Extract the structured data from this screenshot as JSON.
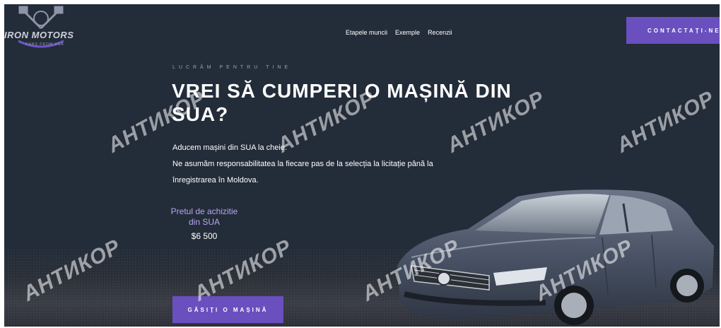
{
  "header": {
    "logo_text": "IRON MOTORS",
    "logo_sub": "CARS FROM USA",
    "nav": [
      "Etapele muncii",
      "Exemple",
      "Recenzii"
    ],
    "contact_label": "CONTACTAȚI-NE"
  },
  "hero": {
    "eyebrow": "LUCRĂM PENTRU TINE",
    "title": "VREI SĂ CUMPERI O MAȘINĂ DIN SUA?",
    "desc_line1": "Aducem mașini din SUA la cheie.",
    "desc_line2": "Ne asumăm responsabilitatea la fiecare pas de la selecția la licitație până la",
    "desc_line3": "înregistrarea în Moldova.",
    "price_label_1": "Pretul de achizitie",
    "price_label_2": "din SUA",
    "price_value": "$6 500",
    "cta_label": "GĂSIȚI O MAȘINĂ"
  },
  "watermark": "АНТИКОР",
  "colors": {
    "background": "#232c39",
    "accent": "#6a4fbf",
    "price_text": "#b8a6f0"
  }
}
